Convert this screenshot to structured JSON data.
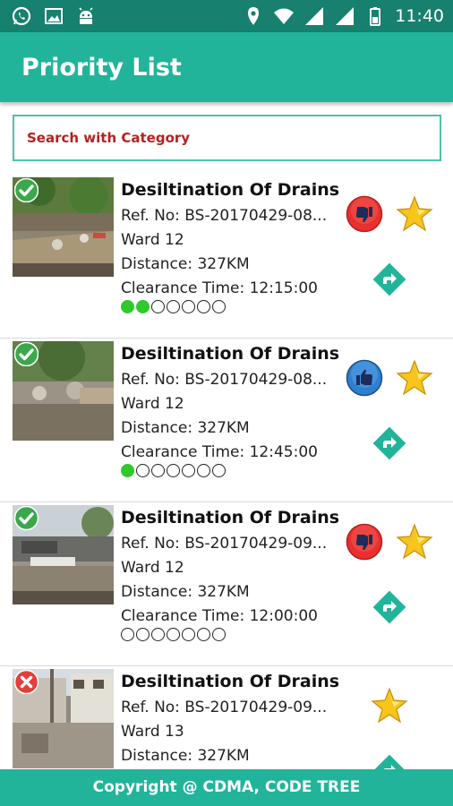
{
  "status_bar": {
    "time": "11:40",
    "left_icons": [
      "whatsapp-icon",
      "gallery-icon",
      "android-debug-icon"
    ],
    "right_icons": [
      "location-icon",
      "wifi-icon",
      "signal-icon",
      "signal-icon-2",
      "battery-icon"
    ]
  },
  "app_bar": {
    "title": "Priority List"
  },
  "search": {
    "placeholder": "Search with Category"
  },
  "colors": {
    "primary": "#22b49b",
    "primary_dark": "#17806f",
    "accent_red": "#b5211f",
    "progress_green": "#2fc92b"
  },
  "items": [
    {
      "title": "Desiltination Of Drains",
      "ref": "Ref. No: BS-20170429-08...",
      "ward": "Ward 12",
      "distance": "Distance: 327KM",
      "clearance": "Clearance Time: 12:15:00",
      "status": "check-icon",
      "vote": "thumbs-down-icon",
      "progress": {
        "filled": 2,
        "total": 7
      }
    },
    {
      "title": "Desiltination Of Drains",
      "ref": "Ref. No: BS-20170429-08...",
      "ward": "Ward 12",
      "distance": "Distance: 327KM",
      "clearance": "Clearance Time: 12:45:00",
      "status": "check-icon",
      "vote": "thumbs-up-icon",
      "progress": {
        "filled": 1,
        "total": 7
      }
    },
    {
      "title": "Desiltination Of Drains",
      "ref": "Ref. No: BS-20170429-09...",
      "ward": "Ward 12",
      "distance": "Distance: 327KM",
      "clearance": "Clearance Time: 12:00:00",
      "status": "check-icon",
      "vote": "thumbs-down-icon",
      "progress": {
        "filled": 0,
        "total": 7
      }
    },
    {
      "title": "Desiltination Of Drains",
      "ref": "Ref. No: BS-20170429-09...",
      "ward": "Ward 13",
      "distance": "Distance: 327KM",
      "clearance": "",
      "status": "cross-icon",
      "vote": "",
      "progress": {
        "filled": 0,
        "total": 0
      }
    }
  ],
  "footer": {
    "text": "Copyright @ CDMA, CODE TREE"
  }
}
